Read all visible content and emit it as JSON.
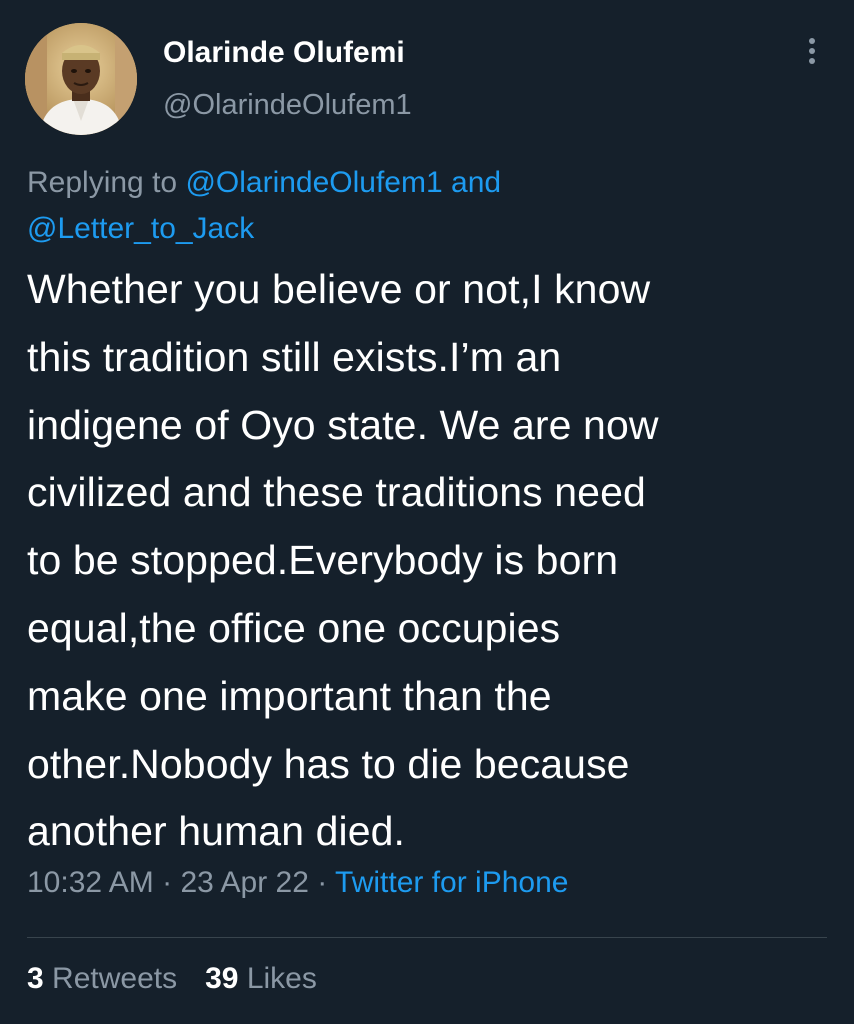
{
  "author": {
    "display_name": "Olarinde Olufemi",
    "handle": "@OlarindeOlufem1"
  },
  "reply": {
    "prefix": "Replying to",
    "mention_1": "@OlarindeOlufem1",
    "conjunction": "and",
    "mention_2": "@Letter_to_Jack"
  },
  "tweet": {
    "lines": [
      "Whether you believe or not,I know",
      "this tradition still exists.I’m an",
      "indigene of Oyo state. We are now",
      "civilized and these traditions need",
      "to be stopped.Everybody is born",
      "equal,the office one occupies",
      "make one important than the",
      "other.Nobody has to die because",
      "another human died."
    ]
  },
  "meta": {
    "time": "10:32 AM",
    "date": "23 Apr 22",
    "separator": "·",
    "source": "Twitter for iPhone"
  },
  "stats": {
    "retweets_count": "3",
    "retweets_label": "Retweets",
    "likes_count": "39",
    "likes_label": "Likes"
  },
  "icons": {
    "more": "more-vertical-icon",
    "avatar": "profile-photo"
  },
  "colors": {
    "background": "#15202b",
    "secondary_text": "#8b98a5",
    "link": "#1d9bf0",
    "primary_text": "#ffffff"
  }
}
